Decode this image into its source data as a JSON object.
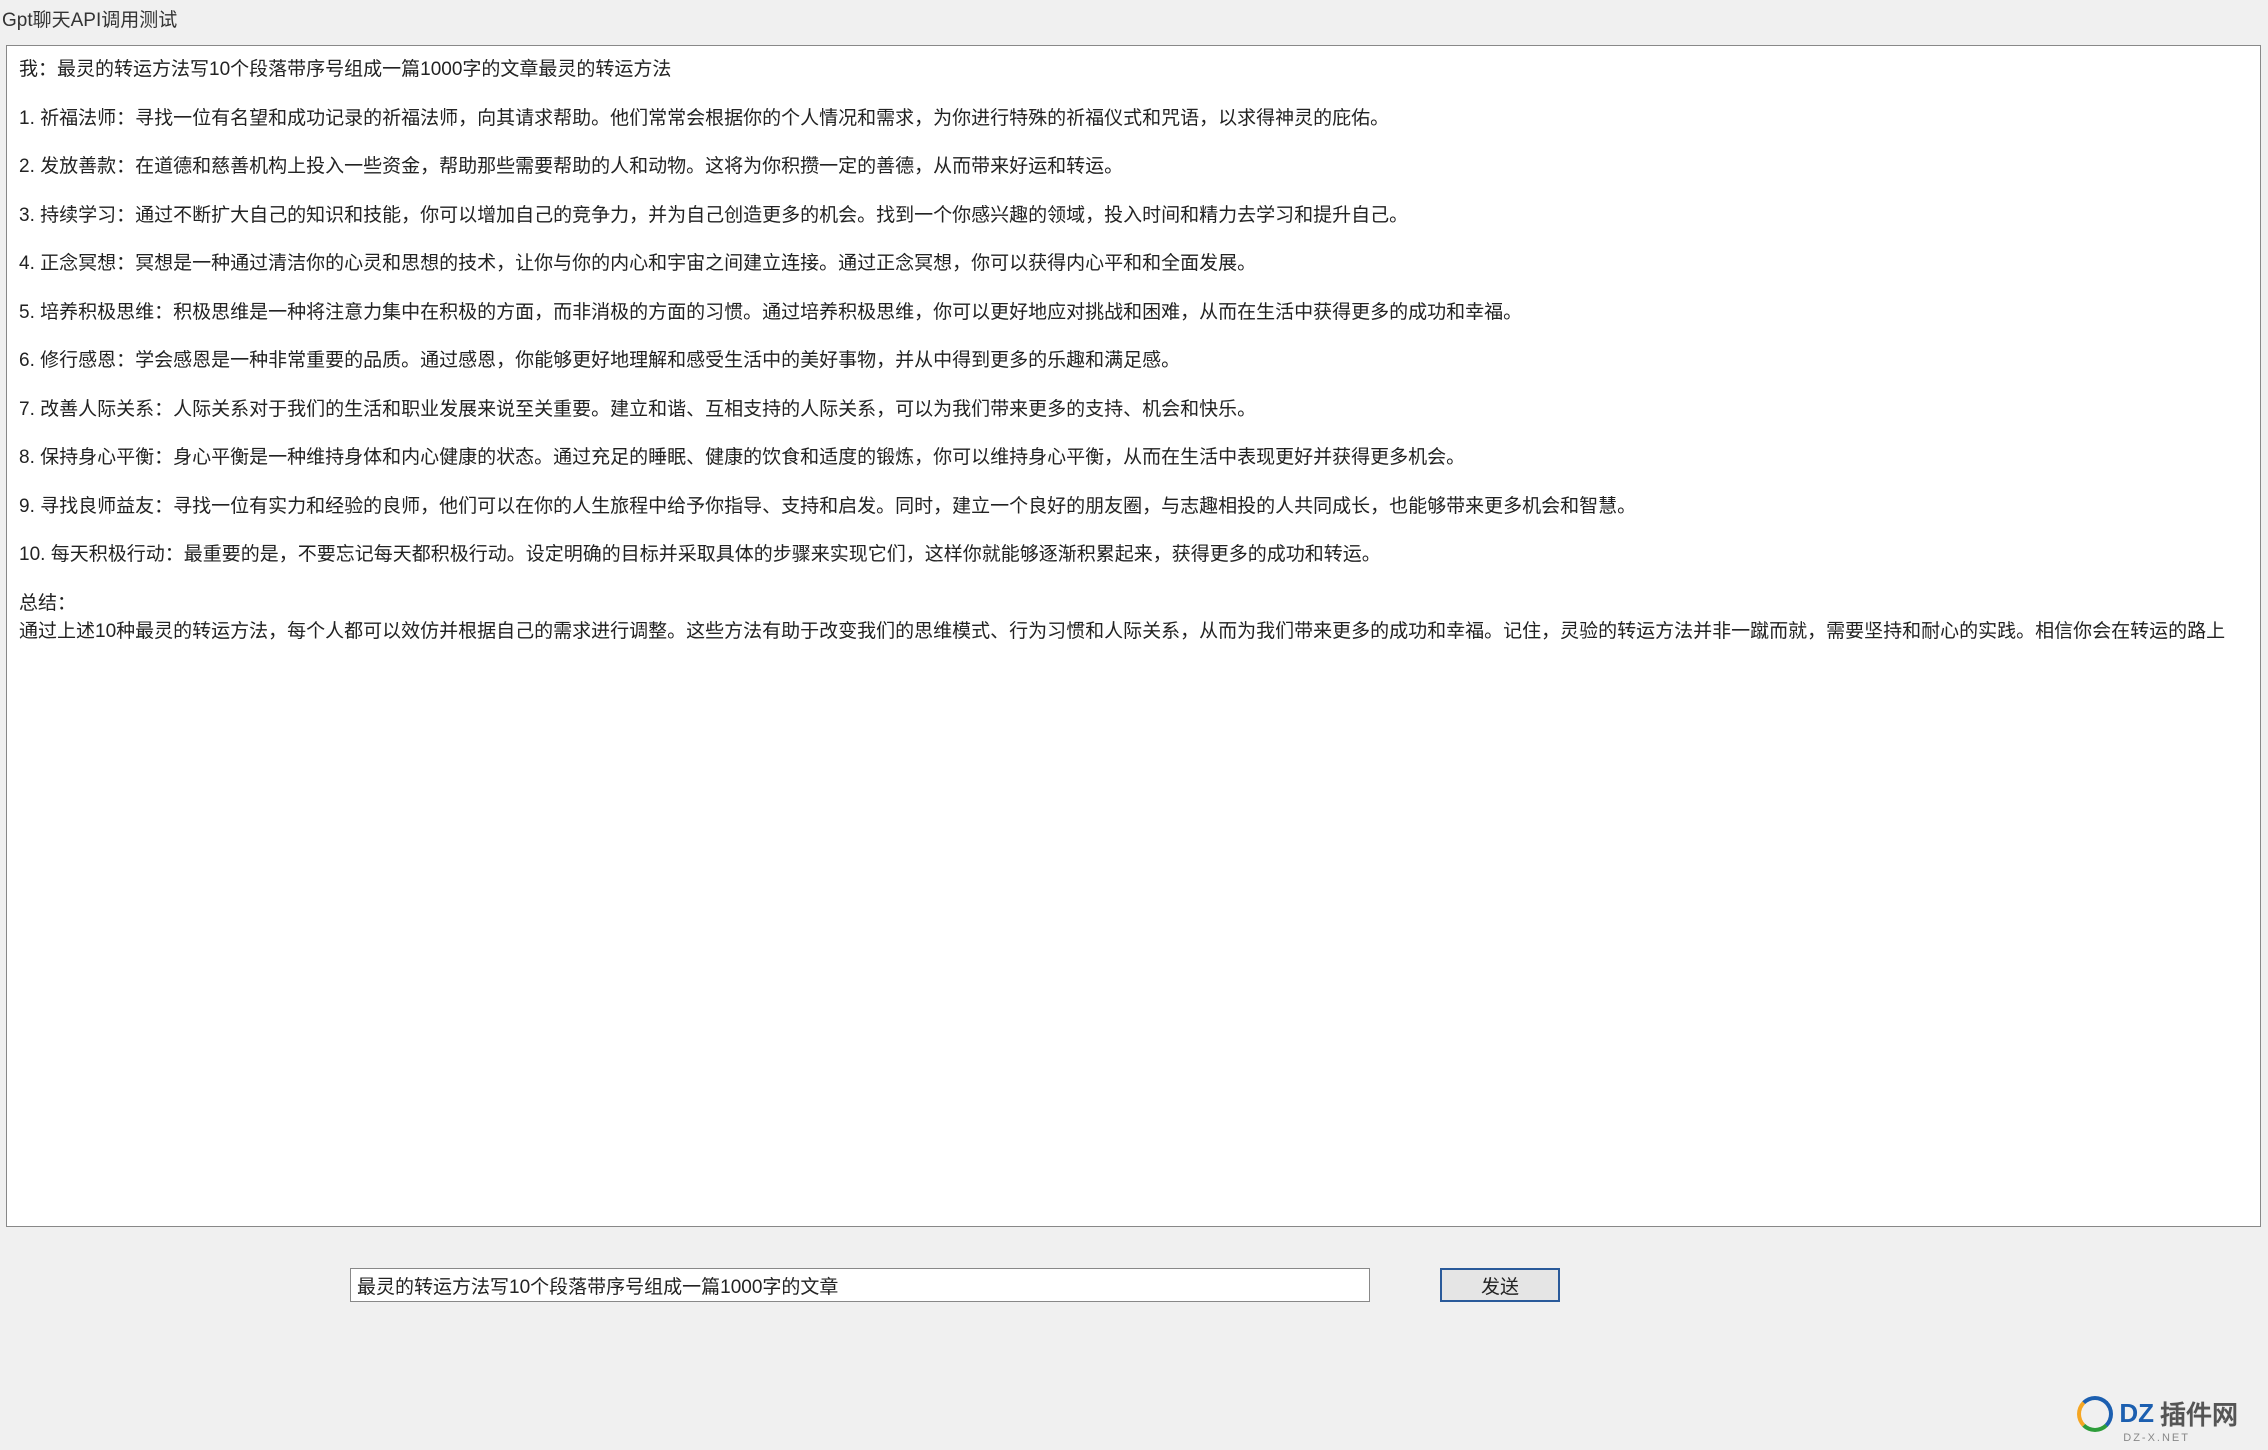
{
  "title": "Gpt聊天API调用测试",
  "chat": {
    "prompt_line": "我：最灵的转运方法写10个段落带序号组成一篇1000字的文章最灵的转运方法",
    "items": [
      "1. 祈福法师：寻找一位有名望和成功记录的祈福法师，向其请求帮助。他们常常会根据你的个人情况和需求，为你进行特殊的祈福仪式和咒语，以求得神灵的庇佑。",
      "2. 发放善款：在道德和慈善机构上投入一些资金，帮助那些需要帮助的人和动物。这将为你积攒一定的善德，从而带来好运和转运。",
      "3. 持续学习：通过不断扩大自己的知识和技能，你可以增加自己的竞争力，并为自己创造更多的机会。找到一个你感兴趣的领域，投入时间和精力去学习和提升自己。",
      "4. 正念冥想：冥想是一种通过清洁你的心灵和思想的技术，让你与你的内心和宇宙之间建立连接。通过正念冥想，你可以获得内心平和和全面发展。",
      "5. 培养积极思维：积极思维是一种将注意力集中在积极的方面，而非消极的方面的习惯。通过培养积极思维，你可以更好地应对挑战和困难，从而在生活中获得更多的成功和幸福。",
      "6. 修行感恩：学会感恩是一种非常重要的品质。通过感恩，你能够更好地理解和感受生活中的美好事物，并从中得到更多的乐趣和满足感。",
      "7. 改善人际关系：人际关系对于我们的生活和职业发展来说至关重要。建立和谐、互相支持的人际关系，可以为我们带来更多的支持、机会和快乐。",
      "8. 保持身心平衡：身心平衡是一种维持身体和内心健康的状态。通过充足的睡眠、健康的饮食和适度的锻炼，你可以维持身心平衡，从而在生活中表现更好并获得更多机会。",
      "9. 寻找良师益友：寻找一位有实力和经验的良师，他们可以在你的人生旅程中给予你指导、支持和启发。同时，建立一个良好的朋友圈，与志趣相投的人共同成长，也能够带来更多机会和智慧。",
      "10. 每天积极行动：最重要的是，不要忘记每天都积极行动。设定明确的目标并采取具体的步骤来实现它们，这样你就能够逐渐积累起来，获得更多的成功和转运。"
    ],
    "summary_label": "总结：",
    "summary_body": "通过上述10种最灵的转运方法，每个人都可以效仿并根据自己的需求进行调整。这些方法有助于改变我们的思维模式、行为习惯和人际关系，从而为我们带来更多的成功和幸福。记住，灵验的转运方法并非一蹴而就，需要坚持和耐心的实践。相信你会在转运的路上"
  },
  "input": {
    "value": "最灵的转运方法写10个段落带序号组成一篇1000字的文章"
  },
  "buttons": {
    "send": "发送"
  },
  "watermark": {
    "dz": "DZ",
    "suffix": "插件网",
    "sub": "DZ-X.NET"
  }
}
